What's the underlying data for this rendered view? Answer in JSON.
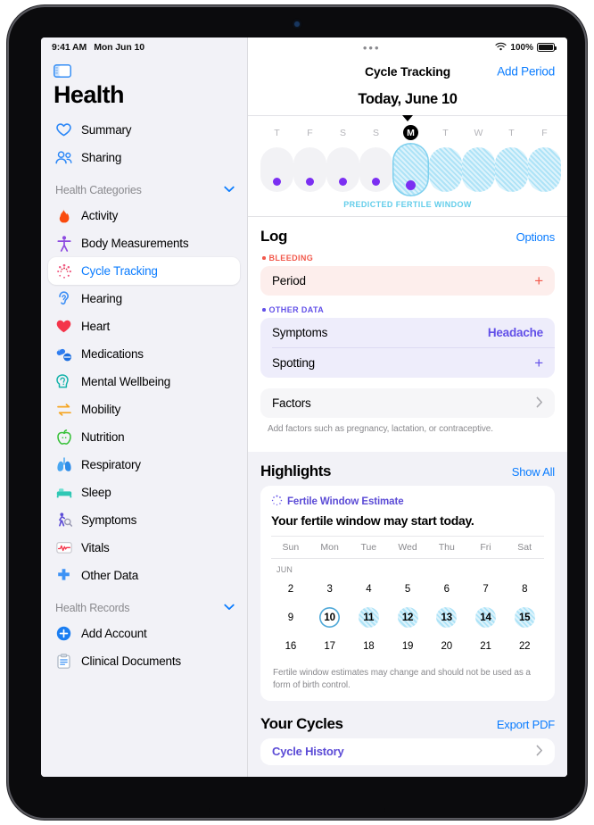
{
  "status_bar": {
    "time": "9:41 AM",
    "date": "Mon Jun 10",
    "wifi_icon": "wifi-icon",
    "battery_percent": "100%",
    "grabber": "•••"
  },
  "sidebar": {
    "toggle_icon": "sidebar-toggle-icon",
    "app_title": "Health",
    "top_items": [
      {
        "label": "Summary",
        "icon": "heart-outline-icon"
      },
      {
        "label": "Sharing",
        "icon": "people-icon"
      }
    ],
    "categories_header": {
      "label": "Health Categories",
      "chevron": "chevron-down-icon"
    },
    "categories": [
      {
        "label": "Activity",
        "icon": "flame-icon"
      },
      {
        "label": "Body Measurements",
        "icon": "body-icon"
      },
      {
        "label": "Cycle Tracking",
        "icon": "cycle-tracking-icon",
        "selected": true
      },
      {
        "label": "Hearing",
        "icon": "ear-icon"
      },
      {
        "label": "Heart",
        "icon": "heart-filled-icon"
      },
      {
        "label": "Medications",
        "icon": "pills-icon"
      },
      {
        "label": "Mental Wellbeing",
        "icon": "brain-head-icon"
      },
      {
        "label": "Mobility",
        "icon": "mobility-arrows-icon"
      },
      {
        "label": "Nutrition",
        "icon": "apple-icon"
      },
      {
        "label": "Respiratory",
        "icon": "lungs-icon"
      },
      {
        "label": "Sleep",
        "icon": "bed-icon"
      },
      {
        "label": "Symptoms",
        "icon": "symptoms-person-icon"
      },
      {
        "label": "Vitals",
        "icon": "vitals-waveform-icon"
      },
      {
        "label": "Other Data",
        "icon": "plus-cross-icon"
      }
    ],
    "records_header": {
      "label": "Health Records",
      "chevron": "chevron-down-icon"
    },
    "records": [
      {
        "label": "Add Account",
        "icon": "add-circle-icon"
      },
      {
        "label": "Clinical Documents",
        "icon": "clipboard-icon"
      }
    ]
  },
  "navbar": {
    "title": "Cycle Tracking",
    "action_label": "Add Period"
  },
  "today_header": "Today, June 10",
  "week_strip": {
    "fertile_label": "PREDICTED FERTILE WINDOW",
    "days": [
      {
        "letter": "T",
        "today": false,
        "fertile": false,
        "dot": true
      },
      {
        "letter": "F",
        "today": false,
        "fertile": false,
        "dot": true
      },
      {
        "letter": "S",
        "today": false,
        "fertile": false,
        "dot": true
      },
      {
        "letter": "S",
        "today": false,
        "fertile": false,
        "dot": true
      },
      {
        "letter": "M",
        "today": true,
        "fertile": true,
        "dot": true
      },
      {
        "letter": "T",
        "today": false,
        "fertile": true,
        "dot": false
      },
      {
        "letter": "W",
        "today": false,
        "fertile": true,
        "dot": false
      },
      {
        "letter": "T",
        "today": false,
        "fertile": true,
        "dot": false
      },
      {
        "letter": "F",
        "today": false,
        "fertile": true,
        "dot": false
      }
    ]
  },
  "log": {
    "title": "Log",
    "options_label": "Options",
    "bleeding_group": "BLEEDING",
    "bleeding_rows": [
      {
        "label": "Period",
        "value": "+"
      }
    ],
    "other_group": "OTHER DATA",
    "other_rows": [
      {
        "label": "Symptoms",
        "value": "Headache"
      },
      {
        "label": "Spotting",
        "value": "+"
      }
    ],
    "factors_label": "Factors",
    "factors_chevron": "chevron-right-icon",
    "factors_caption": "Add factors such as pregnancy, lactation, or contraceptive."
  },
  "highlights": {
    "title": "Highlights",
    "show_all_label": "Show All",
    "card": {
      "kicker_icon": "cycle-tracking-icon",
      "kicker": "Fertile Window Estimate",
      "headline": "Your fertile window may start today.",
      "weekday_headers": [
        "Sun",
        "Mon",
        "Tue",
        "Wed",
        "Thu",
        "Fri",
        "Sat"
      ],
      "month_label": "JUN",
      "weeks": [
        [
          {
            "day": "2",
            "state": "normal"
          },
          {
            "day": "3",
            "state": "normal"
          },
          {
            "day": "4",
            "state": "normal"
          },
          {
            "day": "5",
            "state": "normal"
          },
          {
            "day": "6",
            "state": "normal"
          },
          {
            "day": "7",
            "state": "normal"
          },
          {
            "day": "8",
            "state": "normal"
          }
        ],
        [
          {
            "day": "9",
            "state": "normal"
          },
          {
            "day": "10",
            "state": "today"
          },
          {
            "day": "11",
            "state": "fertile"
          },
          {
            "day": "12",
            "state": "fertile"
          },
          {
            "day": "13",
            "state": "fertile"
          },
          {
            "day": "14",
            "state": "fertile"
          },
          {
            "day": "15",
            "state": "fertile"
          }
        ],
        [
          {
            "day": "16",
            "state": "normal"
          },
          {
            "day": "17",
            "state": "normal"
          },
          {
            "day": "18",
            "state": "normal"
          },
          {
            "day": "19",
            "state": "normal"
          },
          {
            "day": "20",
            "state": "normal"
          },
          {
            "day": "21",
            "state": "normal"
          },
          {
            "day": "22",
            "state": "normal"
          }
        ]
      ],
      "footnote": "Fertile window estimates may change and should not be used as a form of birth control."
    }
  },
  "your_cycles": {
    "title": "Your Cycles",
    "export_label": "Export PDF",
    "rows": [
      {
        "label": "Cycle History",
        "chevron": "chevron-right-icon"
      }
    ]
  },
  "colors": {
    "accent_blue": "#0a7cff",
    "fertile_blue": "#aee3f7",
    "fertile_label": "#62cdea",
    "bleeding_red": "#f2584b",
    "other_purple": "#6250e8",
    "indigo": "#5b4bd6",
    "period_dot": "#7b2ff2",
    "sidebar_bg": "#f2f2f7"
  }
}
